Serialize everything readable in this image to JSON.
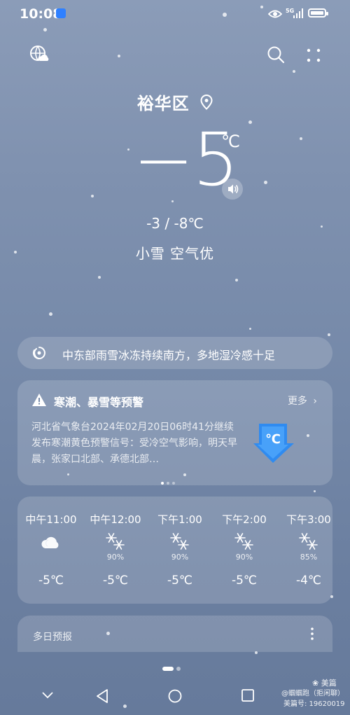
{
  "status_bar": {
    "time": "10:08",
    "network": "5G"
  },
  "location": {
    "name": "裕华区"
  },
  "current": {
    "temp": "−5",
    "unit": "℃",
    "range": "-3 / -8℃",
    "condition": "小雪 空气优"
  },
  "news": {
    "text": "中东部雨雪冰冻持续南方，多地湿冷感十足"
  },
  "alert": {
    "title": "寒潮、暴雪等预警",
    "more": "更多",
    "body": "河北省气象台2024年02月20日06时41分继续发布寒潮黄色预警信号：受冷空气影响，明天早晨，张家口北部、承德北部…",
    "badge": "℃"
  },
  "hourly": [
    {
      "time": "中午11:00",
      "icon": "cloudy-icon",
      "prob": "",
      "temp": "-5℃"
    },
    {
      "time": "中午12:00",
      "icon": "snow-icon",
      "prob": "90%",
      "temp": "-5℃"
    },
    {
      "time": "下午1:00",
      "icon": "snow-icon",
      "prob": "90%",
      "temp": "-5℃"
    },
    {
      "time": "下午2:00",
      "icon": "snow-icon",
      "prob": "90%",
      "temp": "-5℃"
    },
    {
      "time": "下午3:00",
      "icon": "snow-icon",
      "prob": "85%",
      "temp": "-4℃"
    }
  ],
  "multi_day": {
    "title": "多日预报"
  },
  "watermark": {
    "brand": "美篇",
    "line1": "@蝈蝈跑（拒闲聊）",
    "line2": "美篇号: 19620019"
  },
  "colors": {
    "alert_blue": "#2f8bf0",
    "background": "#7f91af"
  }
}
